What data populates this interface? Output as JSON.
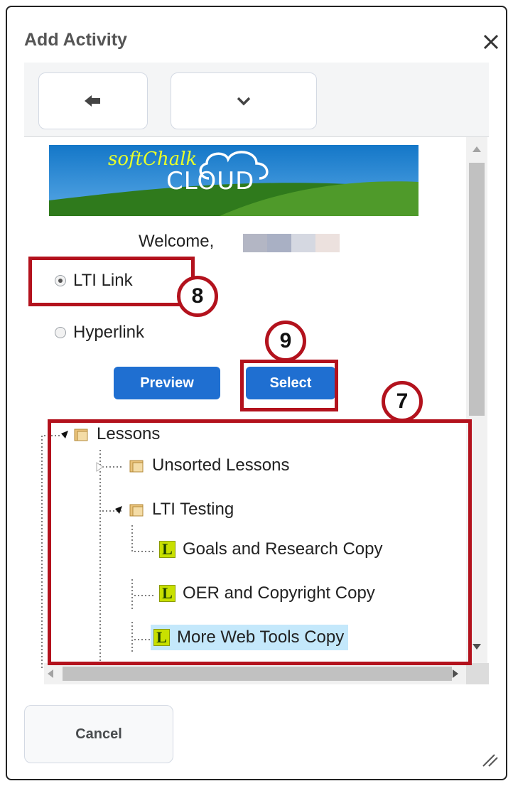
{
  "dialog": {
    "title": "Add Activity",
    "close_icon": "close-icon",
    "toolbar": {
      "back_icon": "arrow-left-icon",
      "menu_icon": "chevron-down-icon"
    }
  },
  "softchalk": {
    "logo_text_top": "softChalk",
    "logo_text_bottom": "CLOUD",
    "welcome": "Welcome,",
    "options": [
      {
        "label": "LTI Link",
        "selected": true
      },
      {
        "label": "Hyperlink",
        "selected": false
      }
    ],
    "preview_label": "Preview",
    "select_label": "Select"
  },
  "tree": {
    "root": "Lessons",
    "folders": [
      "Unsorted Lessons",
      "LTI Testing"
    ],
    "lessons": [
      {
        "label": "Goals and Research Copy",
        "icon_letter": "L",
        "selected": false
      },
      {
        "label": "OER and Copyright Copy",
        "icon_letter": "L",
        "selected": false
      },
      {
        "label": "More Web Tools Copy",
        "icon_letter": "L",
        "selected": true
      }
    ]
  },
  "footer": {
    "cancel_label": "Cancel"
  },
  "callouts": [
    "7",
    "8",
    "9"
  ],
  "colors": {
    "primary_button": "#1f6fd1",
    "callout": "#b3121d",
    "selection": "#c4e8fb",
    "lesson_icon": "#c8e000"
  }
}
